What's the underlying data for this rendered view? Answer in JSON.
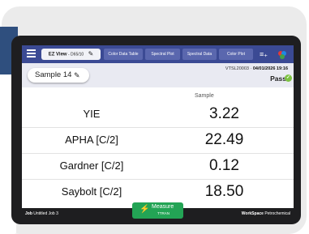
{
  "nav": {
    "menu_icon": "hamburger-icon",
    "active_tab": {
      "label": "EZ View",
      "sub": "- D65/10",
      "icon": "pencil-icon"
    },
    "tabs": [
      "Color Data Table",
      "Spectral Plot",
      "Spectral Data",
      "Color Plot"
    ],
    "list_icon": "list-add-icon",
    "palette_icon": "color-palette-icon",
    "accent": "#3b4a94"
  },
  "header": {
    "sample_label": "Sample 14",
    "sample_icon": "pencil-icon",
    "instrument": "VTSL20003",
    "datetime": "04/01/2026 19:16",
    "status": "Pass",
    "status_icon": "check-circle-icon",
    "status_color": "#7dc242"
  },
  "table": {
    "column_header": "Sample",
    "rows": [
      {
        "name": "YIE",
        "value": "3.22"
      },
      {
        "name": "APHA [C/2]",
        "value": "22.49"
      },
      {
        "name": "Gardner [C/2]",
        "value": "0.12"
      },
      {
        "name": "Saybolt [C/2]",
        "value": "18.50"
      }
    ]
  },
  "footer": {
    "job_label": "Job",
    "job_value": "Untitled Job 3",
    "workspace_label": "WorkSpace",
    "workspace_value": "Petrochemical"
  },
  "measure": {
    "label": "Measure",
    "sub": "TTRAN",
    "icon": "lightning-bolt-icon",
    "color": "#23a455"
  }
}
